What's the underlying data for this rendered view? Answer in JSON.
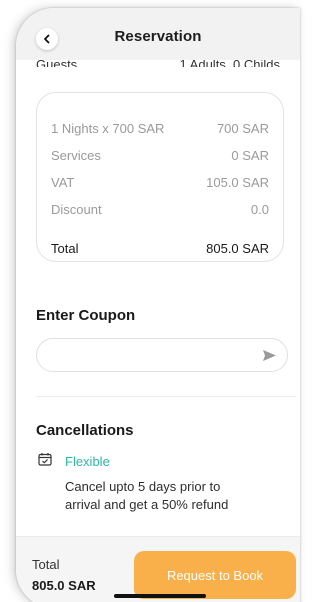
{
  "header": {
    "title": "Reservation",
    "back_icon": "chevron-left-icon"
  },
  "guests_row": {
    "label": "Guests",
    "value": "1 Adults, 0 Childs"
  },
  "price_summary": {
    "rows": [
      {
        "label": "1 Nights x 700 SAR",
        "value": "700 SAR"
      },
      {
        "label": "Services",
        "value": "0 SAR"
      },
      {
        "label": "VAT",
        "value": "105.0 SAR"
      },
      {
        "label": "Discount",
        "value": "0.0"
      }
    ],
    "total": {
      "label": "Total",
      "value": "805.0 SAR"
    }
  },
  "coupon": {
    "title": "Enter Coupon",
    "placeholder": "",
    "value": "",
    "submit_icon": "send-icon"
  },
  "cancellations": {
    "title": "Cancellations",
    "policy_icon": "calendar-check-icon",
    "policy_name": "Flexible",
    "policy_description": "Cancel upto 5 days prior to arrival and get a 50% refund"
  },
  "footer": {
    "total_label": "Total",
    "total_amount": "805.0 SAR",
    "cta_label": "Request to Book"
  },
  "colors": {
    "accent": "#f9b04a",
    "policy": "#2ab7a9",
    "header_bg": "#f2f2f2"
  }
}
